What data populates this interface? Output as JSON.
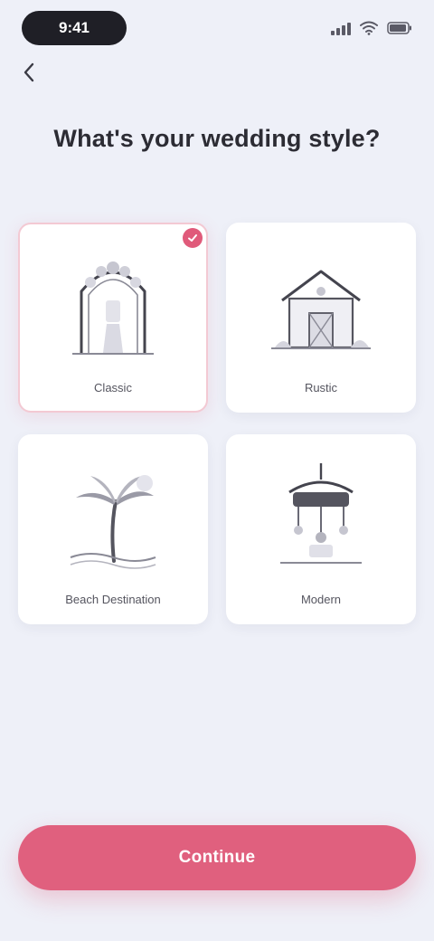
{
  "status_bar": {
    "time": "9:41"
  },
  "screen": {
    "title": "What's your wedding style?"
  },
  "options": [
    {
      "label": "Classic",
      "icon": "wedding-arch-icon",
      "selected": true
    },
    {
      "label": "Rustic",
      "icon": "barn-icon",
      "selected": false
    },
    {
      "label": "Beach Destination",
      "icon": "palm-tree-icon",
      "selected": false
    },
    {
      "label": "Modern",
      "icon": "chandelier-icon",
      "selected": false
    }
  ],
  "cta": {
    "label": "Continue"
  },
  "colors": {
    "accent": "#e0607e",
    "background": "#eef0f8",
    "card": "#ffffff"
  }
}
